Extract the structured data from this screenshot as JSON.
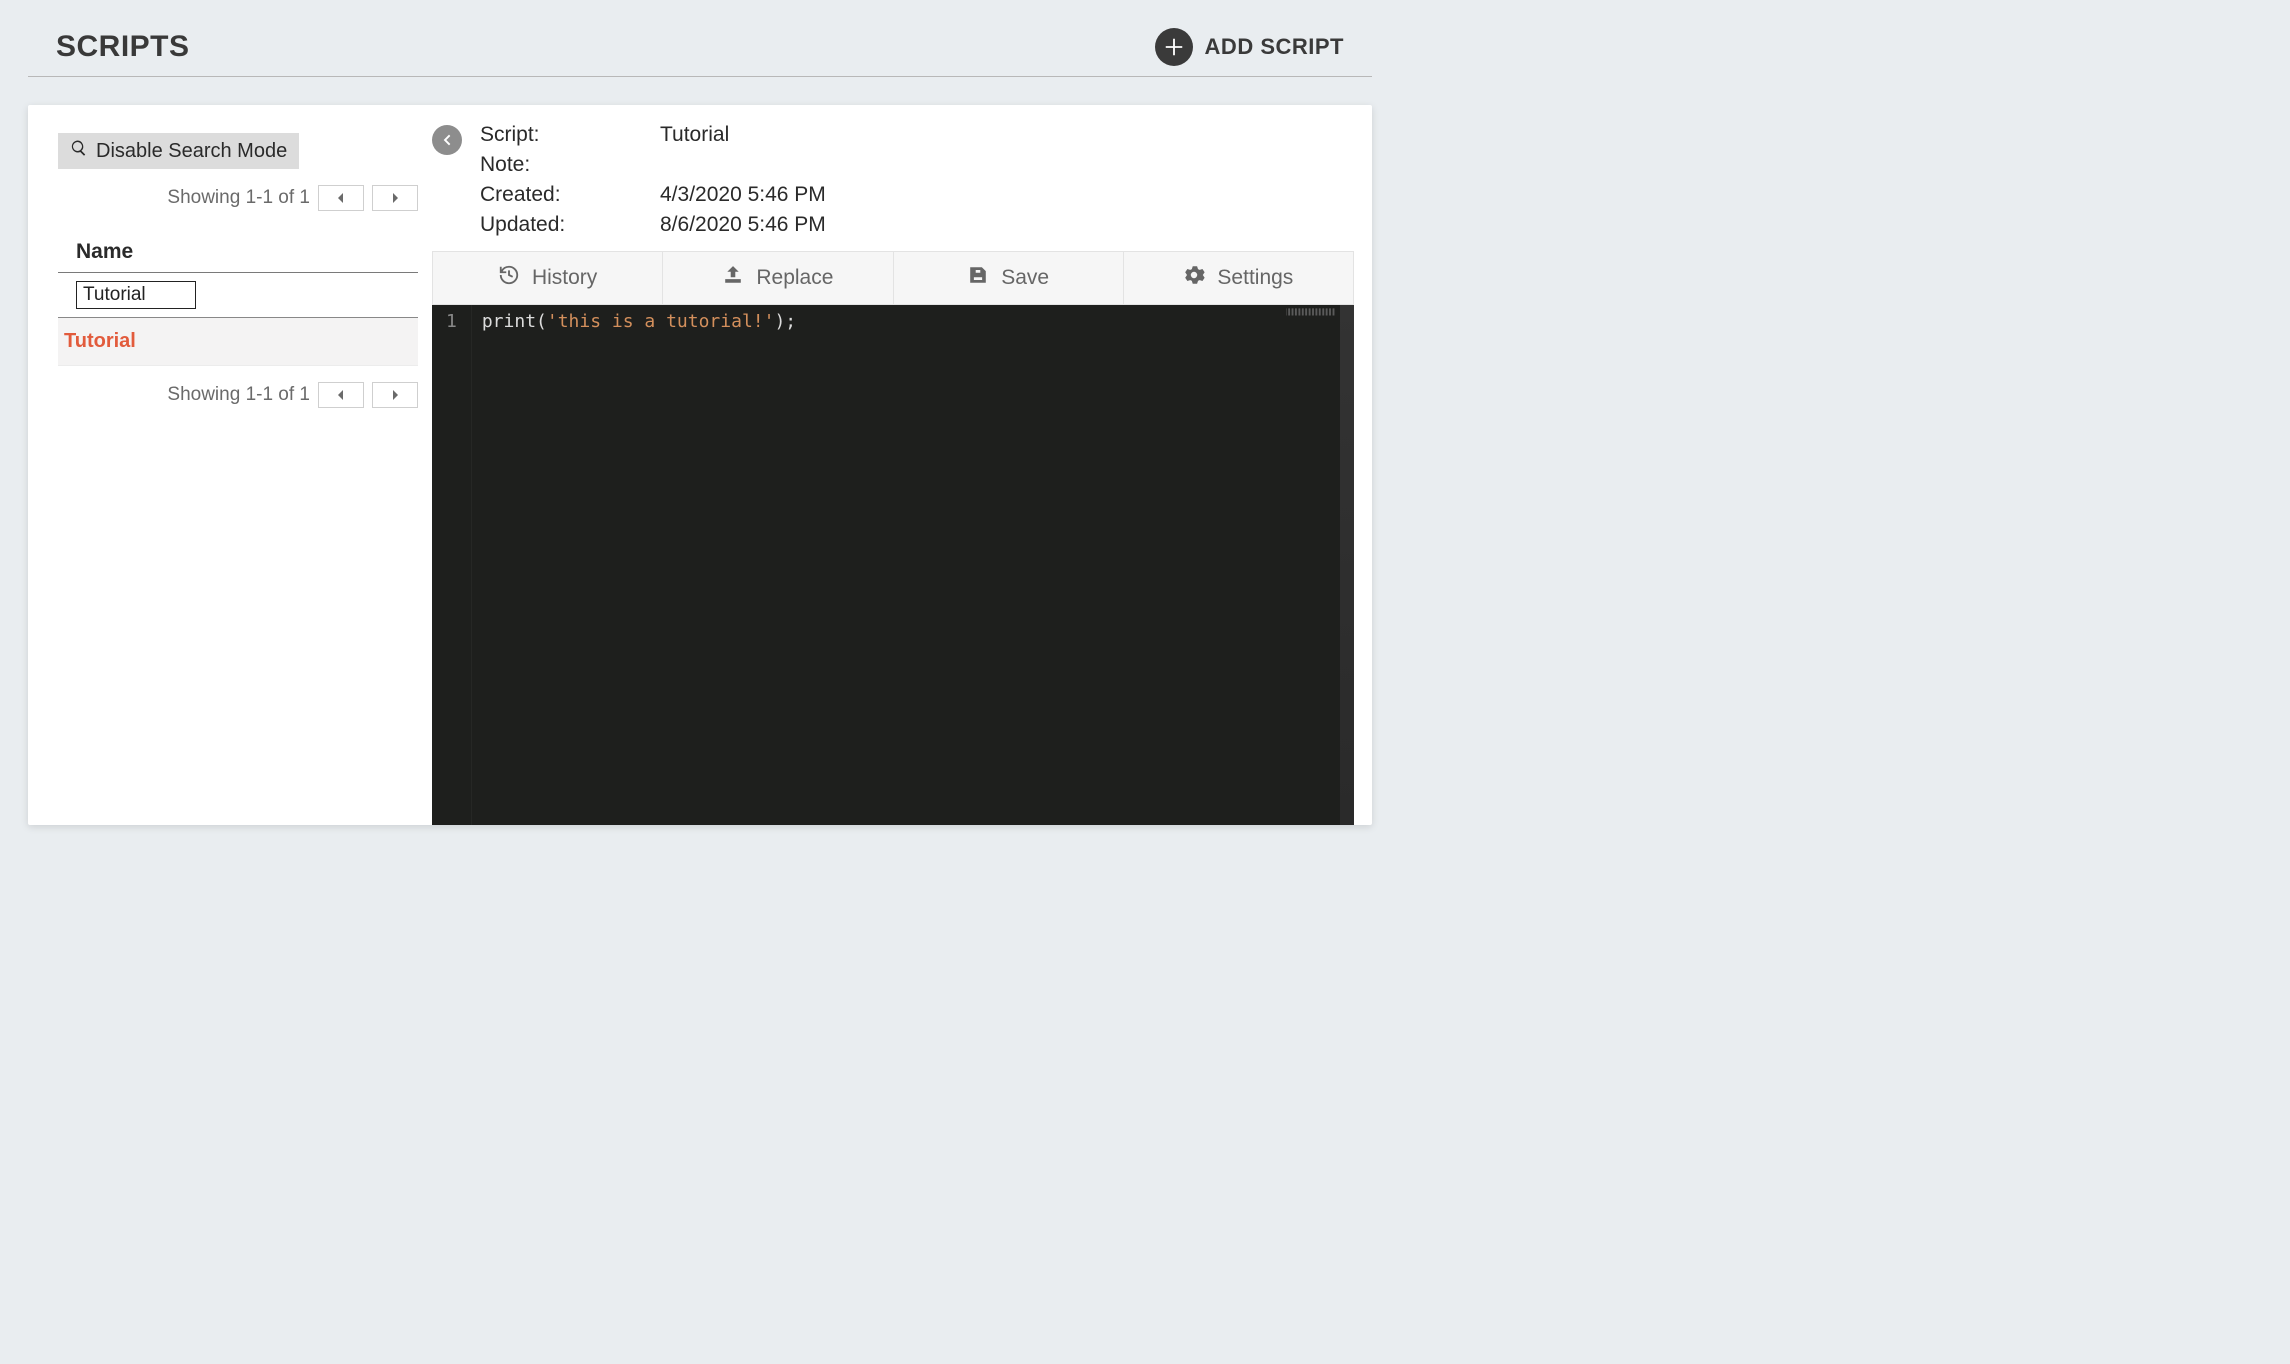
{
  "header": {
    "title": "SCRIPTS",
    "add_label": "ADD SCRIPT"
  },
  "left": {
    "search_mode_label": "Disable Search Mode",
    "showing_text_top": "Showing 1-1 of 1",
    "showing_text_bottom": "Showing 1-1 of 1",
    "column_header": "Name",
    "filter_value": "Tutorial",
    "rows": [
      {
        "name": "Tutorial"
      }
    ]
  },
  "detail": {
    "labels": {
      "script": "Script:",
      "note": "Note:",
      "created": "Created:",
      "updated": "Updated:"
    },
    "values": {
      "script": "Tutorial",
      "note": "",
      "created": "4/3/2020 5:46 PM",
      "updated": "8/6/2020 5:46 PM"
    }
  },
  "toolbar": {
    "history": "History",
    "replace": "Replace",
    "save": "Save",
    "settings": "Settings"
  },
  "editor": {
    "line_number": "1",
    "code_fn": "print",
    "code_open": "(",
    "code_str": "'this is a tutorial!'",
    "code_close": ");"
  }
}
